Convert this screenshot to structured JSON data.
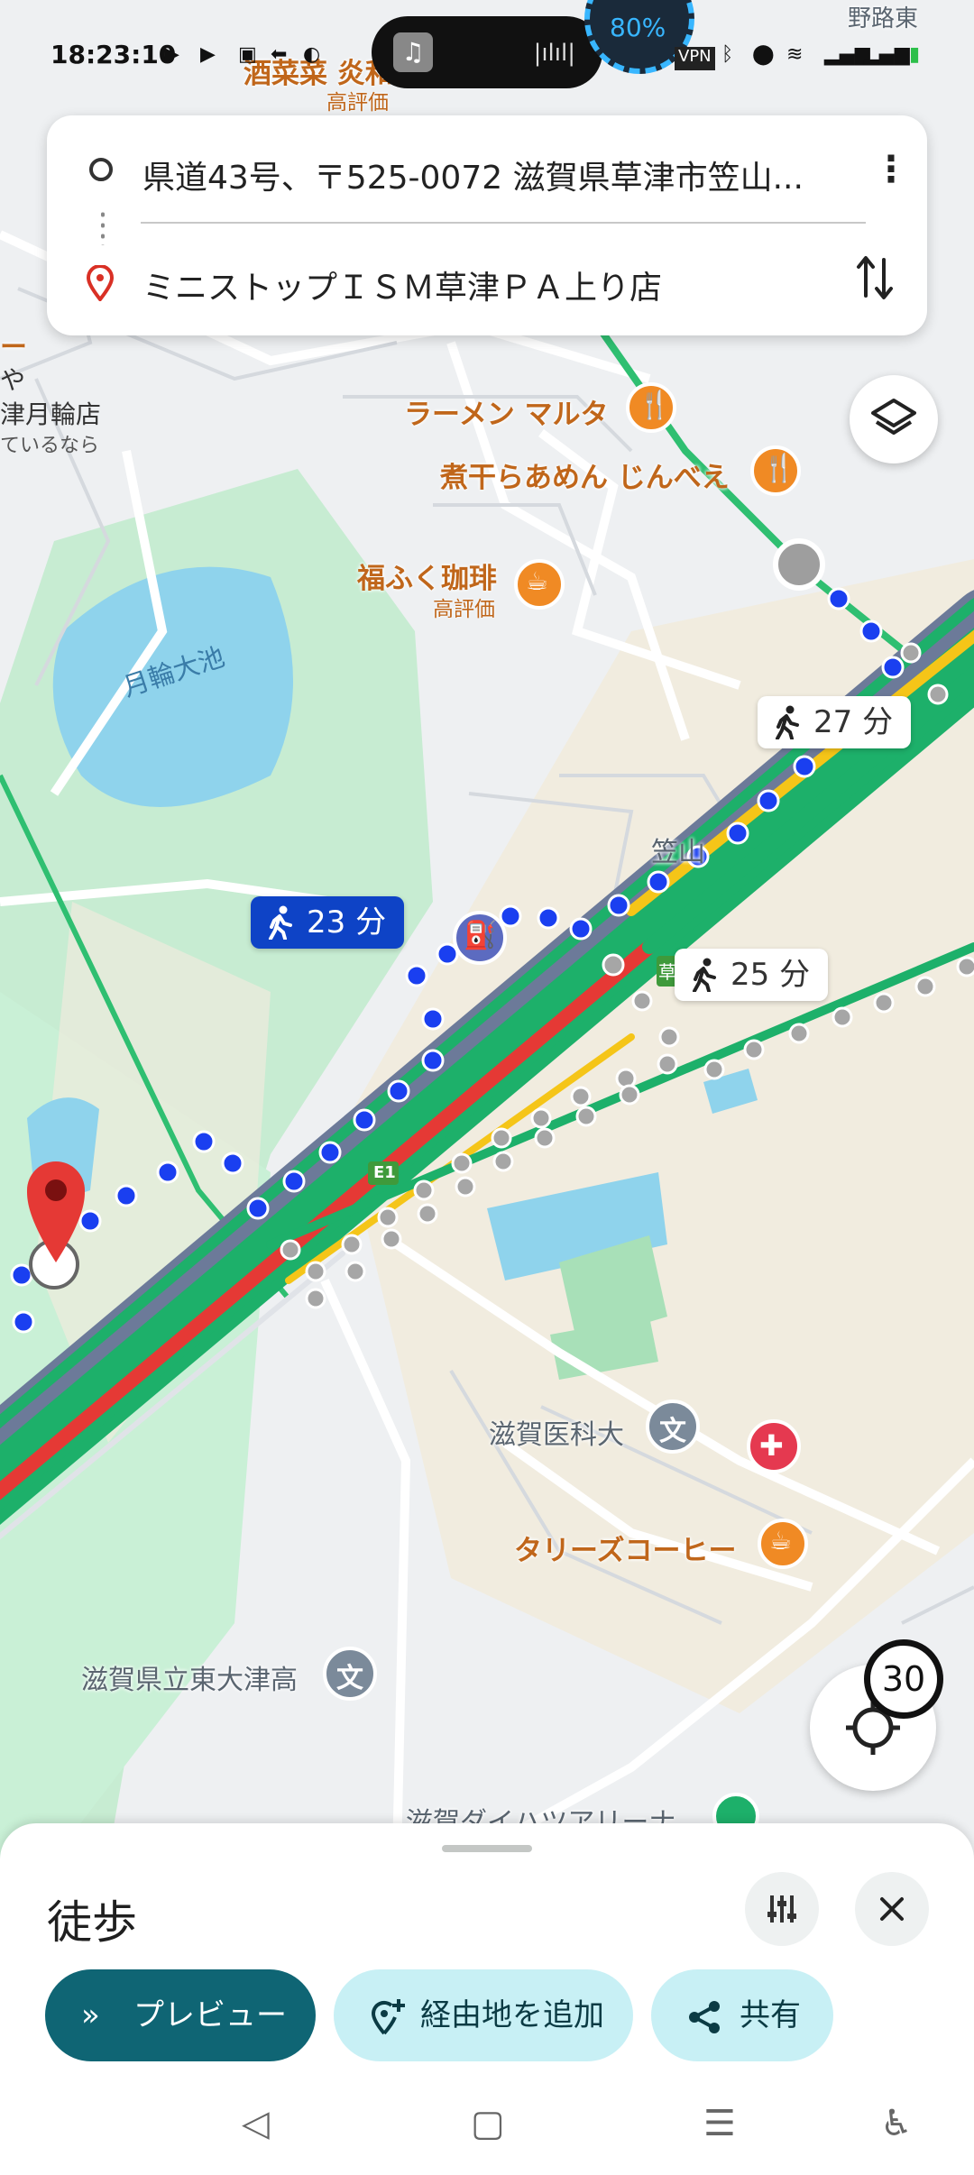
{
  "status_bar": {
    "time": "18:23:10",
    "battery_percent": "80%",
    "vpn": "VPN"
  },
  "route_card": {
    "origin": "県道43号、〒525-0072 滋賀県草津市笠山...",
    "destination": "ミニストップＩＳＭ草津ＰＡ上り店"
  },
  "map": {
    "pois": [
      {
        "name": "ラーメン マルタ",
        "kind": "restaurant"
      },
      {
        "name": "煮干らあめん じんべえ",
        "kind": "restaurant"
      },
      {
        "name": "福ふく珈琲",
        "sub": "高評価",
        "kind": "cafe"
      },
      {
        "name": "滋賀医科大",
        "kind": "school"
      },
      {
        "name": "タリーズコーヒー",
        "kind": "cafe"
      },
      {
        "name": "滋賀県立東大津高",
        "kind": "school"
      },
      {
        "name": "滋賀ダイハツアリーナ",
        "kind": "stadium"
      }
    ],
    "top_partial_poi": {
      "name": "酒菜菜 炎和",
      "sub": "高評価"
    },
    "left_partial_labels": [
      "ー",
      "や",
      "津月輪店",
      "ているなら"
    ],
    "lake_label": "月輪大池",
    "place_label": "笠山",
    "top_right_label": "野路東",
    "highway_shield": "E1",
    "highway_shield_2": "草",
    "route_durations": [
      {
        "label": "23 分",
        "selected": true
      },
      {
        "label": "25 分",
        "selected": false
      },
      {
        "label": "27 分",
        "selected": false
      }
    ],
    "speed_limit": "30"
  },
  "bottom_sheet": {
    "mode_title": "徒歩",
    "preview_label": "プレビュー",
    "add_waypoint_label": "経由地を追加",
    "share_label": "共有"
  },
  "colors": {
    "route_selected": "#1a3ff0",
    "route_alt": "#a6a6a6",
    "highway_green": "#1db06a",
    "highway_red": "#e53935",
    "poi_orange": "#f08a24",
    "primary_button": "#0f6574"
  }
}
